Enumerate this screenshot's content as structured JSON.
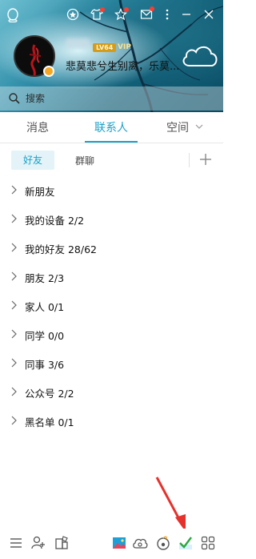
{
  "header": {
    "level_tag": "LV64",
    "vip_tag": "VIP",
    "nickname": "悲莫悲兮生别离，乐莫..."
  },
  "search": {
    "placeholder": "搜索"
  },
  "main_tabs": [
    {
      "label": "消息"
    },
    {
      "label": "联系人",
      "active": true
    },
    {
      "label": "空间"
    }
  ],
  "sub_tabs": [
    {
      "label": "好友",
      "active": true
    },
    {
      "label": "群聊"
    }
  ],
  "groups": [
    {
      "label": "新朋友"
    },
    {
      "label": "我的设备 2/2"
    },
    {
      "label": "我的好友 28/62"
    },
    {
      "label": "朋友 2/3"
    },
    {
      "label": "家人 0/1"
    },
    {
      "label": "同学 0/0"
    },
    {
      "label": "同事 3/6"
    },
    {
      "label": "公众号 2/2"
    },
    {
      "label": "黑名单 0/1"
    }
  ],
  "colors": {
    "accent": "#1aa2c8",
    "annotation_arrow": "#e5322d"
  },
  "icons": {
    "top": [
      "qq-logo-icon",
      "settings-badge-icon",
      "skin-shirt-icon",
      "star-icon",
      "mail-icon",
      "more-vertical-icon",
      "minimize-icon",
      "close-icon"
    ],
    "toolbar": [
      "menu-icon",
      "add-contact-icon",
      "app-manager-icon",
      "photo-icon",
      "weiyun-cloud-icon",
      "music-icon",
      "task-check-icon",
      "grid-apps-icon"
    ]
  }
}
